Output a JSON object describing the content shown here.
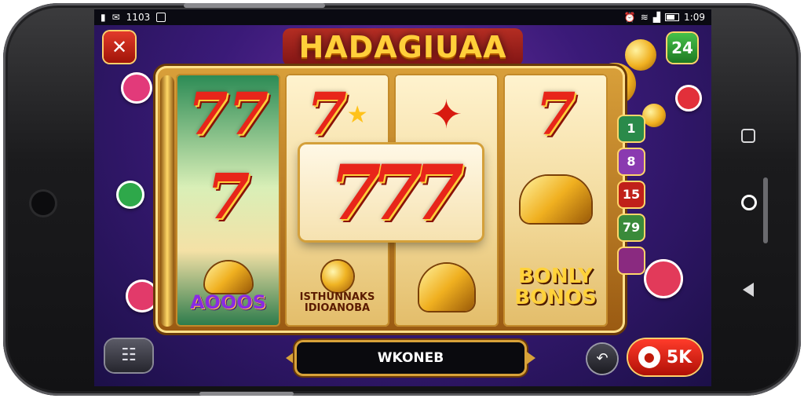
{
  "status_bar": {
    "time": "1103",
    "right_text": "1:09"
  },
  "game": {
    "title": "HADAGIUAA",
    "level_badge": "24"
  },
  "reels": {
    "big_win_symbol": "777",
    "reel1": {
      "bottom_label": "AOOOS"
    },
    "reel2": {
      "bottom_label_line1": "ISTHUNNAKS",
      "bottom_label_line2": "IDIOANOBA"
    },
    "reel4": {
      "bottom_label_line1": "BONLY",
      "bottom_label_line2": "BONOS"
    }
  },
  "multipliers": [
    "1",
    "8",
    "15",
    "79",
    ""
  ],
  "controls": {
    "win_label": "WKONEB",
    "bet_value": "5K"
  },
  "icons": {
    "close": "close-x-icon",
    "menu": "menu-grid-icon",
    "autospin": "refresh-arrow-icon",
    "bet": "chip-icon"
  },
  "colors": {
    "accent_gold": "#ffcf3a",
    "bet_red": "#ff3b2a",
    "background_purple": "#3a1a78"
  }
}
